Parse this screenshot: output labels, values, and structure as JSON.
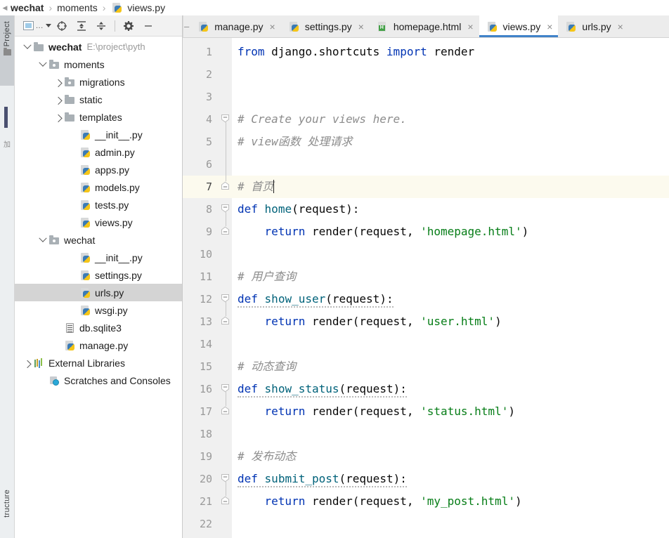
{
  "breadcrumb": {
    "back_icon": "chevron-left-icon",
    "items": [
      {
        "label": "wechat",
        "bold": true
      },
      {
        "label": "moments",
        "bold": false
      },
      {
        "label": "views.py",
        "bold": false,
        "icon": "python-file-icon"
      }
    ],
    "separator": "›"
  },
  "left_strip": {
    "project_tab": "Project",
    "structure_tab": "tructure",
    "favorites_hint": "加"
  },
  "project_panel": {
    "toolbar": {
      "view_selector_label": "...",
      "buttons": [
        {
          "name": "project-view-select",
          "icon": "project-view-icon"
        },
        {
          "name": "scroll-from-source",
          "icon": "crosshair-target-icon"
        },
        {
          "name": "expand-all",
          "icon": "expand-all-icon"
        },
        {
          "name": "collapse-all",
          "icon": "collapse-all-icon"
        },
        {
          "name": "settings",
          "icon": "gear-icon"
        },
        {
          "name": "hide",
          "icon": "minimize-icon"
        }
      ]
    },
    "tree": [
      {
        "label": "wechat",
        "path": "E:\\project\\pyth",
        "icon": "folder-icon",
        "twisty": "open",
        "indent": 0,
        "bold": true,
        "selected": false
      },
      {
        "label": "moments",
        "path": "",
        "icon": "module-folder-icon",
        "twisty": "open",
        "indent": 1,
        "bold": false,
        "selected": false
      },
      {
        "label": "migrations",
        "path": "",
        "icon": "module-folder-icon",
        "twisty": "closed",
        "indent": 2,
        "bold": false,
        "selected": false
      },
      {
        "label": "static",
        "path": "",
        "icon": "folder-icon",
        "twisty": "closed",
        "indent": 2,
        "bold": false,
        "selected": false
      },
      {
        "label": "templates",
        "path": "",
        "icon": "folder-icon",
        "twisty": "closed",
        "indent": 2,
        "bold": false,
        "selected": false
      },
      {
        "label": "__init__.py",
        "path": "",
        "icon": "python-file-icon",
        "twisty": "none",
        "indent": 3,
        "bold": false,
        "selected": false
      },
      {
        "label": "admin.py",
        "path": "",
        "icon": "python-file-icon",
        "twisty": "none",
        "indent": 3,
        "bold": false,
        "selected": false
      },
      {
        "label": "apps.py",
        "path": "",
        "icon": "python-file-icon",
        "twisty": "none",
        "indent": 3,
        "bold": false,
        "selected": false
      },
      {
        "label": "models.py",
        "path": "",
        "icon": "python-file-icon",
        "twisty": "none",
        "indent": 3,
        "bold": false,
        "selected": false
      },
      {
        "label": "tests.py",
        "path": "",
        "icon": "python-file-icon",
        "twisty": "none",
        "indent": 3,
        "bold": false,
        "selected": false
      },
      {
        "label": "views.py",
        "path": "",
        "icon": "python-file-icon",
        "twisty": "none",
        "indent": 3,
        "bold": false,
        "selected": false
      },
      {
        "label": "wechat",
        "path": "",
        "icon": "module-folder-icon",
        "twisty": "open",
        "indent": 1,
        "bold": false,
        "selected": false
      },
      {
        "label": "__init__.py",
        "path": "",
        "icon": "python-file-icon",
        "twisty": "none",
        "indent": 3,
        "bold": false,
        "selected": false
      },
      {
        "label": "settings.py",
        "path": "",
        "icon": "python-file-icon",
        "twisty": "none",
        "indent": 3,
        "bold": false,
        "selected": false
      },
      {
        "label": "urls.py",
        "path": "",
        "icon": "python-file-icon",
        "twisty": "none",
        "indent": 3,
        "bold": false,
        "selected": true
      },
      {
        "label": "wsgi.py",
        "path": "",
        "icon": "python-file-icon",
        "twisty": "none",
        "indent": 3,
        "bold": false,
        "selected": false
      },
      {
        "label": "db.sqlite3",
        "path": "",
        "icon": "database-file-icon",
        "twisty": "none",
        "indent": 2,
        "bold": false,
        "selected": false
      },
      {
        "label": "manage.py",
        "path": "",
        "icon": "python-file-icon",
        "twisty": "none",
        "indent": 2,
        "bold": false,
        "selected": false
      },
      {
        "label": "External Libraries",
        "path": "",
        "icon": "external-libraries-icon",
        "twisty": "closed",
        "indent": 0,
        "bold": false,
        "selected": false
      },
      {
        "label": "Scratches and Consoles",
        "path": "",
        "icon": "scratches-icon",
        "twisty": "none",
        "indent": 1,
        "bold": false,
        "selected": false
      }
    ]
  },
  "editor": {
    "tabs": [
      {
        "label": "manage.py",
        "icon": "python-file-icon",
        "active": false,
        "close": "×"
      },
      {
        "label": "settings.py",
        "icon": "python-file-icon",
        "active": false,
        "close": "×"
      },
      {
        "label": "homepage.html",
        "icon": "html-file-icon",
        "active": false,
        "close": "×"
      },
      {
        "label": "views.py",
        "icon": "python-file-icon",
        "active": true,
        "close": "×"
      },
      {
        "label": "urls.py",
        "icon": "python-file-icon",
        "active": false,
        "close": "×"
      }
    ],
    "active_tab_accent": "#4083c9",
    "current_line": 7,
    "lines": [
      {
        "n": 1,
        "fold": "none",
        "tokens": [
          {
            "t": "from",
            "c": "k"
          },
          {
            "t": " django.shortcuts ",
            "c": "pl"
          },
          {
            "t": "import",
            "c": "k"
          },
          {
            "t": " render",
            "c": "pl"
          }
        ]
      },
      {
        "n": 2,
        "fold": "none",
        "tokens": []
      },
      {
        "n": 3,
        "fold": "none",
        "tokens": []
      },
      {
        "n": 4,
        "fold": "open",
        "tokens": [
          {
            "t": "# Create your views here.",
            "c": "cm"
          }
        ]
      },
      {
        "n": 5,
        "fold": "none",
        "tokens": [
          {
            "t": "# view函数 处理请求",
            "c": "cm"
          }
        ]
      },
      {
        "n": 6,
        "fold": "none",
        "tokens": []
      },
      {
        "n": 7,
        "fold": "end",
        "tokens": [
          {
            "t": "# 首页",
            "c": "cm"
          }
        ],
        "caret": true
      },
      {
        "n": 8,
        "fold": "open",
        "tokens": [
          {
            "t": "def",
            "c": "k"
          },
          {
            "t": " ",
            "c": "pl"
          },
          {
            "t": "home",
            "c": "fn"
          },
          {
            "t": "(request):",
            "c": "pl"
          }
        ]
      },
      {
        "n": 9,
        "fold": "end",
        "tokens": [
          {
            "t": "    ",
            "c": "pl"
          },
          {
            "t": "return",
            "c": "k"
          },
          {
            "t": " render(request, ",
            "c": "pl"
          },
          {
            "t": "'homepage.html'",
            "c": "st"
          },
          {
            "t": ")",
            "c": "pl"
          }
        ]
      },
      {
        "n": 10,
        "fold": "none",
        "tokens": []
      },
      {
        "n": 11,
        "fold": "none",
        "tokens": [
          {
            "t": "# 用户查询",
            "c": "cm"
          }
        ]
      },
      {
        "n": 12,
        "fold": "open",
        "tokens": [
          {
            "t": "def",
            "c": "k"
          },
          {
            "t": " ",
            "c": "pl"
          },
          {
            "t": "show_user",
            "c": "fn"
          },
          {
            "t": "(request):",
            "c": "pl"
          }
        ],
        "warn": true
      },
      {
        "n": 13,
        "fold": "end",
        "tokens": [
          {
            "t": "    ",
            "c": "pl"
          },
          {
            "t": "return",
            "c": "k"
          },
          {
            "t": " render(request, ",
            "c": "pl"
          },
          {
            "t": "'user.html'",
            "c": "st"
          },
          {
            "t": ")",
            "c": "pl"
          }
        ]
      },
      {
        "n": 14,
        "fold": "none",
        "tokens": []
      },
      {
        "n": 15,
        "fold": "none",
        "tokens": [
          {
            "t": "# 动态查询",
            "c": "cm"
          }
        ]
      },
      {
        "n": 16,
        "fold": "open",
        "tokens": [
          {
            "t": "def",
            "c": "k"
          },
          {
            "t": " ",
            "c": "pl"
          },
          {
            "t": "show_status",
            "c": "fn"
          },
          {
            "t": "(request):",
            "c": "pl"
          }
        ],
        "warn": true
      },
      {
        "n": 17,
        "fold": "end",
        "tokens": [
          {
            "t": "    ",
            "c": "pl"
          },
          {
            "t": "return",
            "c": "k"
          },
          {
            "t": " render(request, ",
            "c": "pl"
          },
          {
            "t": "'status.html'",
            "c": "st"
          },
          {
            "t": ")",
            "c": "pl"
          }
        ]
      },
      {
        "n": 18,
        "fold": "none",
        "tokens": []
      },
      {
        "n": 19,
        "fold": "none",
        "tokens": [
          {
            "t": "# 发布动态",
            "c": "cm"
          }
        ]
      },
      {
        "n": 20,
        "fold": "open",
        "tokens": [
          {
            "t": "def",
            "c": "k"
          },
          {
            "t": " ",
            "c": "pl"
          },
          {
            "t": "submit_post",
            "c": "fn"
          },
          {
            "t": "(request):",
            "c": "pl"
          }
        ],
        "warn": true
      },
      {
        "n": 21,
        "fold": "end",
        "tokens": [
          {
            "t": "    ",
            "c": "pl"
          },
          {
            "t": "return",
            "c": "k"
          },
          {
            "t": " render(request, ",
            "c": "pl"
          },
          {
            "t": "'my_post.html'",
            "c": "st"
          },
          {
            "t": ")",
            "c": "pl"
          }
        ]
      },
      {
        "n": 22,
        "fold": "none",
        "tokens": []
      }
    ]
  },
  "colors": {
    "keyword": "#0033b3",
    "function": "#00627a",
    "string": "#067d17",
    "comment": "#8c8c8c",
    "current_line_bg": "#fcfaee",
    "selection_bg": "#d4d4d4",
    "tab_accent": "#4083c9"
  }
}
